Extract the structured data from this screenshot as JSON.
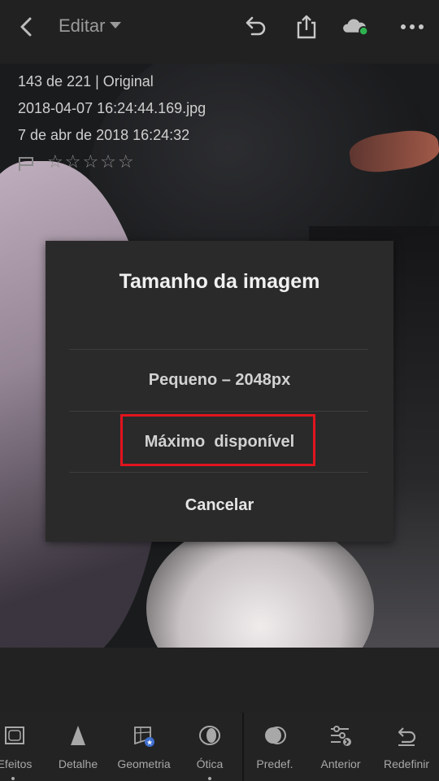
{
  "header": {
    "title": "Editar"
  },
  "photo_info": {
    "position": "143 de 221 | Original",
    "filename": "2018-04-07 16:24:44.169.jpg",
    "date": "7 de abr de 2018 16:24:32",
    "stars": "☆☆☆☆☆"
  },
  "dialog": {
    "title": "Tamanho da imagem",
    "option_small": "Pequeno – 2048px",
    "option_max": "Máximo  disponível",
    "cancel": "Cancelar"
  },
  "toolbar": {
    "items": [
      {
        "label": "Efeitos"
      },
      {
        "label": "Detalhe"
      },
      {
        "label": "Geometria"
      },
      {
        "label": "Ótica"
      },
      {
        "label": "Predef."
      },
      {
        "label": "Anterior"
      },
      {
        "label": "Redefinir"
      }
    ]
  },
  "colors": {
    "highlight": "#e0141e",
    "sync_dot": "#2fb350"
  }
}
